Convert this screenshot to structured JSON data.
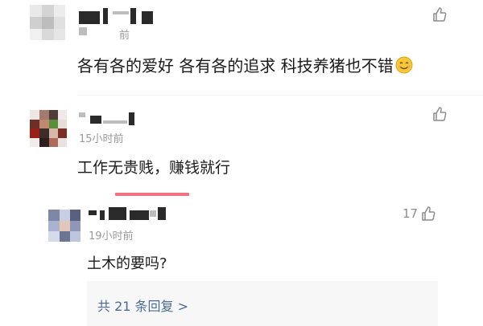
{
  "comments": [
    {
      "timestamp": "前",
      "text": "各有各的爱好 各有各的追求 科技养猪也不错",
      "emoji_icon": "smiling-face-emoji"
    },
    {
      "timestamp": "15小时前",
      "text": "工作无贵贱，赚钱就行"
    },
    {
      "timestamp": "19小时前",
      "text": "土木的要吗?",
      "likes": "17",
      "replies_link": "共 21 条回复 >"
    }
  ],
  "icons": {
    "like": "thumbs-up-outline-icon"
  },
  "colors": {
    "link": "#4a6b95",
    "timestamp": "#9a9a9a",
    "text": "#1a1a1a",
    "reply_bg": "#f7f7f7",
    "accent_bar": "#f2707f"
  }
}
